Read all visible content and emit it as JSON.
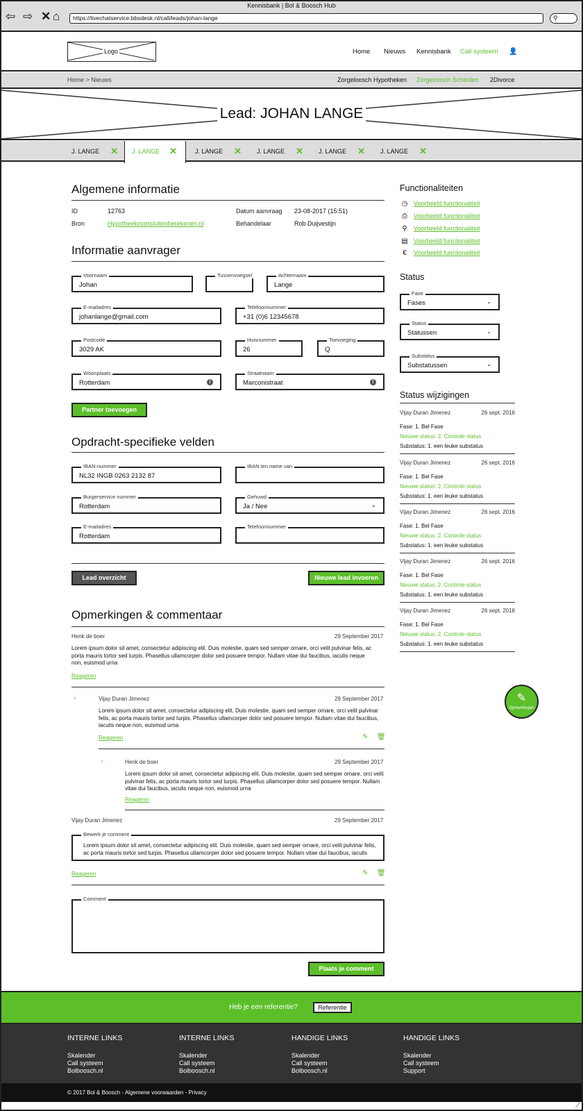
{
  "browser": {
    "window_title": "Kennisbank | Bol & Boosch Hub",
    "url": "https://livechatservice.bbsdesk.nl/call/leads/johan-lange"
  },
  "header": {
    "logo": "Logo",
    "nav": [
      "Home",
      "Nieuws",
      "Kennisbank",
      "Call systeem"
    ]
  },
  "breadcrumb": "Home > Nieuws",
  "subnav": [
    "Zorgeloosch Hypotheken",
    "Zorgeloosch Scheiden",
    "2Divorce"
  ],
  "hero_title": "Lead: JOHAN LANGE",
  "tabs": [
    {
      "label": "J. LANGE"
    },
    {
      "label": "J. LANGE"
    },
    {
      "label": "J. LANGE"
    },
    {
      "label": "J. LANGE"
    },
    {
      "label": "J. LANGE"
    },
    {
      "label": "J. LANGE"
    }
  ],
  "algemeen": {
    "title": "Algemene informatie",
    "id_label": "ID",
    "id": "12763",
    "bron_label": "Bron",
    "bron": "Hypotheekoversluitenberekenen.nl",
    "datum_label": "Datum aanvraag",
    "datum": "23-08-2017 (15:51)",
    "behandelaar_label": "Behandelaar",
    "behandelaar": "Rob Duijvestijn"
  },
  "aanvrager": {
    "title": "Informatie aanvrager",
    "voornaam": {
      "label": "Voornaam",
      "value": "Johan"
    },
    "tussenvoegsel": {
      "label": "Tussenvoegsel",
      "value": ""
    },
    "achternaam": {
      "label": "Achternaam",
      "value": "Lange"
    },
    "email": {
      "label": "E-mailadres",
      "value": "johanlange@gmail.com"
    },
    "telefoon": {
      "label": "Telefoonnummer",
      "value": "+31 (0)6 12345678"
    },
    "postcode": {
      "label": "Postcode",
      "value": "3029 AK"
    },
    "huisnummer": {
      "label": "Huisnummer",
      "value": "26"
    },
    "toevoeging": {
      "label": "Toevoeging",
      "value": "Q"
    },
    "woonplaats": {
      "label": "Woonplaats",
      "value": "Rotterdam"
    },
    "straatnaam": {
      "label": "Straatnaam",
      "value": "Marconistraat"
    },
    "partner_button": "Partner toevoegen"
  },
  "opdracht": {
    "title": "Opdracht-specifieke velden",
    "iban": {
      "label": "IBAN-nummer",
      "value": "NL32 INGB 0263 2132 87"
    },
    "iban_naam": {
      "label": "IBAN ten name van",
      "value": ""
    },
    "bsn": {
      "label": "Burgerservice nummer",
      "value": "Rotterdam"
    },
    "gehuwd": {
      "label": "Gehuwd",
      "value": "Ja / Nee"
    },
    "email": {
      "label": "E-mailadres",
      "value": "Rotterdam"
    },
    "telefoon": {
      "label": "Telefoonnummer",
      "value": ""
    }
  },
  "actions": {
    "overzicht": "Lead overzicht",
    "nieuwe": "Nieuwe lead invoeren"
  },
  "sidebar": {
    "func_title": "Functionaliteiten",
    "func_items": [
      {
        "icon": "clock-icon",
        "glyph": "◷",
        "label": "Voorbeeld functionaliteit"
      },
      {
        "icon": "print-icon",
        "glyph": "⎙",
        "label": "Voorbeeld functionaliteit"
      },
      {
        "icon": "search-icon",
        "glyph": "⚲",
        "label": "Voorbeeld functionaliteit"
      },
      {
        "icon": "book-icon",
        "glyph": "▤",
        "label": "Voorbeeld functionaliteit"
      },
      {
        "icon": "euro-icon",
        "glyph": "€",
        "label": "Voorbeeld functionaliteit"
      }
    ],
    "status_title": "Status",
    "fase": {
      "label": "Fase",
      "value": "Fases"
    },
    "status": {
      "label": "Status",
      "value": "Statussen"
    },
    "substatus": {
      "label": "Substatus",
      "value": "Substatussen"
    },
    "changes_title": "Status wijzigingen",
    "changes": [
      {
        "who": "Vijay Duran Jimenez",
        "date": "26 sept. 2016",
        "fase": "Fase: 1. Bel Fase",
        "status": "Nieuwe status: 2. Controle status",
        "sub": "Substatus: 1. een leuke substatus"
      },
      {
        "who": "Vijay Duran Jimenez",
        "date": "26 sept. 2016",
        "fase": "Fase: 1. Bel Fase",
        "status": "Nieuwe status: 2. Controle status",
        "sub": "Substatus: 1. een leuke substatus"
      },
      {
        "who": "Vijay Duran Jimenez",
        "date": "26 sept. 2016",
        "fase": "Fase: 1. Bel Fase",
        "status": "Nieuwe status: 2. Controle status",
        "sub": "Substatus: 1. een leuke substatus"
      },
      {
        "who": "Vijay Duran Jimenez",
        "date": "26 sept. 2016",
        "fase": "Fase: 1. Bel Fase",
        "status": "Nieuwe status: 2. Controle status",
        "sub": "Substatus: 1. een leuke substatus"
      },
      {
        "who": "Vijay Duran Jimenez",
        "date": "26 sept. 2016",
        "fase": "Fase: 1. Bel Fase",
        "status": "Nieuwe status: 2. Controle status",
        "sub": "Substatus: 1. een leuke substatus"
      }
    ]
  },
  "comments": {
    "title": "Opmerkingen & commentaar",
    "reply": "Reageren",
    "c1": {
      "author": "Henk de boer",
      "date": "29 September 2017",
      "text": "Lorem ipsum dolor sit amet, consectetur adipiscing elit. Duis molestie, quam sed semper ornare, orci velit pulvinar felis, ac porta mauris tortor sed turpis. Phasellus ullamcorper dolor sed posuere tempor. Nullam vitae dui faucibus, iaculis neque non, euismod urna"
    },
    "c2": {
      "author": "Vijay Duran Jimenez",
      "date": "29 September 2017",
      "text": "Lorem ipsum dolor sit amet, consectetur adipiscing elit. Duis molestie, quam sed semper ornare, orci velit pulvinar felis, ac porta mauris tortor sed turpis. Phasellus ullamcorper dolor sed posuere tempor. Nullam vitae dui faucibus, iaculis neque non, euismod urna"
    },
    "c3": {
      "author": "Henk de boer",
      "date": "29 September 2017",
      "text": "Lorem ipsum dolor sit amet, consectetur adipiscing elit. Duis molestie, quam sed semper ornare, orci velit pulvinar felis, ac porta mauris tortor sed turpis. Phasellus ullamcorper dolor sed posuere tempor. Nullam vitae dui faucibus, iaculis neque non, euismod urna"
    },
    "c4": {
      "author": "Vijay Duran Jimenez",
      "date": "29 September 2017",
      "edit_label": "Bewerk je comment",
      "text": "Lorem ipsum dolor sit amet, consectetur adipiscing elit. Duis molestie, quam sed semper ornare, orci velit pulvinar felis, ac porta mauris tortor sed turpis. Phasellus ullamcorper dolor sed posuere tempor. Nullam vitae dui faucibus, iaculis"
    },
    "new_label": "Comment",
    "submit": "Plaats je comment",
    "fab": "Opmerkingen"
  },
  "referral": {
    "text": "Heb je een referentie?",
    "button": "Referentie"
  },
  "footer": {
    "cols": [
      {
        "title": "INTERNE LINKS",
        "items": [
          "Skalender",
          "Call systeem",
          "Bolboosch.nl"
        ]
      },
      {
        "title": "INTERNE LINKS",
        "items": [
          "Skalender",
          "Call systeem",
          "Bolboosch.nl"
        ]
      },
      {
        "title": "HANDIGE LINKS",
        "items": [
          "Skalender",
          "Call systeem",
          "Bolboosch.nl"
        ]
      },
      {
        "title": "HANDIGE LINKS",
        "items": [
          "Skalender",
          "Call systeem",
          "Support"
        ]
      }
    ],
    "copyright": "© 2017 Bol & Boosch - Algemene voorwaarden - Privacy"
  },
  "colors": {
    "accent": "#5cbf2a",
    "chrome": "#dddddd",
    "footer": "#333333"
  }
}
